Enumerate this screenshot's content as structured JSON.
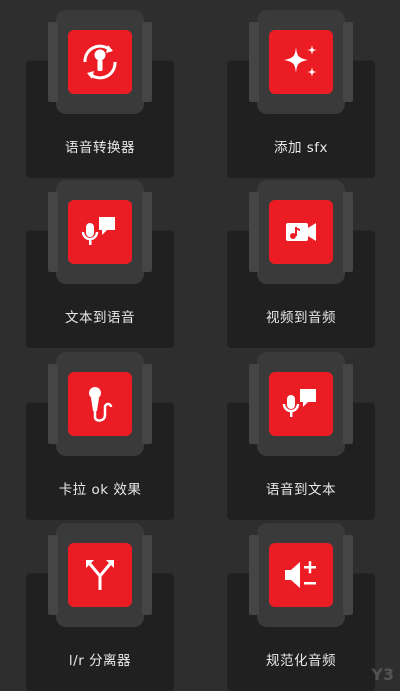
{
  "features": [
    {
      "label": "语音转换器",
      "icon": "voice-changer-icon"
    },
    {
      "label": "添加 sfx",
      "icon": "sparkle-icon"
    },
    {
      "label": "文本到语音",
      "icon": "text-to-speech-icon"
    },
    {
      "label": "视频到音频",
      "icon": "video-to-audio-icon"
    },
    {
      "label": "卡拉 ok 效果",
      "icon": "karaoke-icon"
    },
    {
      "label": "语音到文本",
      "icon": "speech-to-text-icon"
    },
    {
      "label": "l/r 分离器",
      "icon": "split-icon"
    },
    {
      "label": "规范化音频",
      "icon": "normalize-audio-icon"
    }
  ],
  "watermark": "Y3",
  "colors": {
    "accent": "#ec1c24",
    "background": "#2e2e2e"
  }
}
